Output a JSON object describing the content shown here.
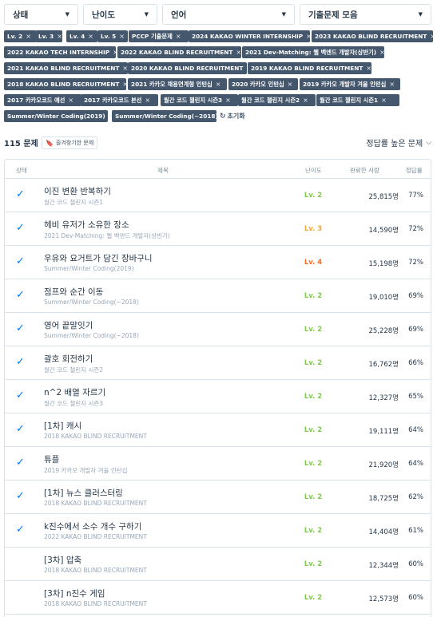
{
  "filters": {
    "status": "상태",
    "level": "난이도",
    "language": "언어",
    "collection": "기출문제 모음"
  },
  "chips": [
    "Lv. 2",
    "Lv. 3",
    "Lv. 4",
    "Lv. 5",
    "PCCP 기출문제",
    "2024 KAKAO WINTER INTERNSHIP",
    "2023 KAKAO BLIND RECRUITMENT",
    "2022 KAKAO TECH INTERNSHIP",
    "2022 KAKAO BLIND RECRUITMENT",
    "2021 Dev-Matching: 웹 백엔드 개발자(상반기)",
    "2021 KAKAO BLIND RECRUITMENT",
    "2020 KAKAO BLIND RECRUITMENT",
    "2019 KAKAO BLIND RECRUITMENT",
    "2018 KAKAO BLIND RECRUITMENT",
    "2021 카카오 채용연계형 인턴십",
    "2020 카카오 인턴십",
    "2019 카카오 개발자 겨울 인턴십",
    "2017 카카오코드 예선",
    "2017 카카오코드 본선",
    "월간 코드 챌린지 시즌3",
    "월간 코드 챌린지 시즌2",
    "월간 코드 챌린지 시즌1",
    "Summer/Winter Coding(2019)",
    "Summer/Winter Coding(~2018)"
  ],
  "chip_remove_icon": "×",
  "reset_label": "초기화",
  "count_label": "115 문제",
  "favorites_label": "즐겨찾기한 문제",
  "sort_label": "정답률 높은 문제",
  "columns": {
    "status": "상태",
    "title": "제목",
    "level": "난이도",
    "completed": "완료한 사람",
    "rate": "정답률"
  },
  "level_colors": {
    "Lv. 2": "#81c94c",
    "Lv. 3": "#f2a735",
    "Lv. 4": "#f36e27"
  },
  "rows": [
    {
      "solved": true,
      "title": "이진 변환 반복하기",
      "sub": "월간 코드 챌린지 시즌1",
      "level": "Lv. 2",
      "done": "25,815명",
      "rate": "77%"
    },
    {
      "solved": true,
      "title": "헤비 유저가 소유한 장소",
      "sub": "2021 Dev-Matching: 웹 백엔드 개발자(상반기)",
      "level": "Lv. 3",
      "done": "14,590명",
      "rate": "72%"
    },
    {
      "solved": true,
      "title": "우유와 요거트가 담긴 장바구니",
      "sub": "Summer/Winter Coding(2019)",
      "level": "Lv. 4",
      "done": "15,198명",
      "rate": "72%"
    },
    {
      "solved": true,
      "title": "점프와 순간 이동",
      "sub": "Summer/Winter Coding(~2018)",
      "level": "Lv. 2",
      "done": "19,010명",
      "rate": "69%"
    },
    {
      "solved": true,
      "title": "영어 끝말잇기",
      "sub": "Summer/Winter Coding(~2018)",
      "level": "Lv. 2",
      "done": "25,228명",
      "rate": "69%"
    },
    {
      "solved": true,
      "title": "괄호 회전하기",
      "sub": "월간 코드 챌린지 시즌2",
      "level": "Lv. 2",
      "done": "16,762명",
      "rate": "66%"
    },
    {
      "solved": true,
      "title": "n^2 배열 자르기",
      "sub": "월간 코드 챌린지 시즌3",
      "level": "Lv. 2",
      "done": "12,327명",
      "rate": "65%"
    },
    {
      "solved": true,
      "title": "[1차] 캐시",
      "sub": "2018 KAKAO BLIND RECRUITMENT",
      "level": "Lv. 2",
      "done": "19,111명",
      "rate": "64%"
    },
    {
      "solved": true,
      "title": "튜플",
      "sub": "2019 카카오 개발자 겨울 인턴십",
      "level": "Lv. 2",
      "done": "21,920명",
      "rate": "64%"
    },
    {
      "solved": true,
      "title": "[1차] 뉴스 클러스터링",
      "sub": "2018 KAKAO BLIND RECRUITMENT",
      "level": "Lv. 2",
      "done": "18,725명",
      "rate": "62%"
    },
    {
      "solved": true,
      "title": "k진수에서 소수 개수 구하기",
      "sub": "2022 KAKAO BLIND RECRUITMENT",
      "level": "Lv. 2",
      "done": "14,404명",
      "rate": "61%"
    },
    {
      "solved": false,
      "title": "[3차] 압축",
      "sub": "2018 KAKAO BLIND RECRUITMENT",
      "level": "Lv. 2",
      "done": "12,344명",
      "rate": "60%"
    },
    {
      "solved": false,
      "title": "[3차] n진수 게임",
      "sub": "2018 KAKAO BLIND RECRUITMENT",
      "level": "Lv. 2",
      "done": "12,573명",
      "rate": "60%"
    }
  ]
}
